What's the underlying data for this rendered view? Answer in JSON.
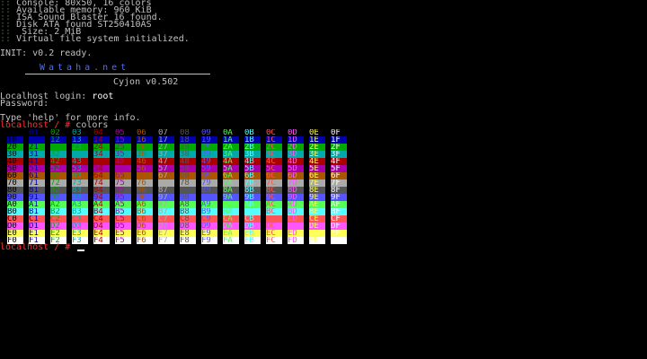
{
  "boot": {
    "lines": [
      "Console: 80x50, 16 colors",
      "Available memory: 960 KiB",
      "ISA Sound Blaster 16 found.",
      "Disk ATA found ST250410AS",
      " Size: 2 MiB",
      "Virtual file system initialized."
    ],
    "bullet": "::"
  },
  "init": {
    "label": "INIT:",
    "text": " v0.2 ready."
  },
  "banner": {
    "name": "Wataha.net",
    "version": "Cyjon v0.502"
  },
  "login": {
    "prompt": "Localhost login: ",
    "user": "root",
    "password_label": "Password:",
    "hint": "Type 'help' for more info."
  },
  "command": {
    "prompt": "localhost / # ",
    "text": "colors"
  },
  "final_prompt": "localhost / # ",
  "palette": {
    "rows": [
      [
        "00",
        "01",
        "02",
        "03",
        "04",
        "05",
        "06",
        "07",
        "08",
        "09",
        "0A",
        "0B",
        "0C",
        "0D",
        "0E",
        "0F"
      ],
      [
        "10",
        "11",
        "12",
        "13",
        "14",
        "15",
        "16",
        "17",
        "18",
        "19",
        "1A",
        "1B",
        "1C",
        "1D",
        "1E",
        "1F"
      ],
      [
        "20",
        "21",
        "22",
        "23",
        "24",
        "25",
        "26",
        "27",
        "28",
        "29",
        "2A",
        "2B",
        "2C",
        "2D",
        "2E",
        "2F"
      ],
      [
        "30",
        "31",
        "32",
        "33",
        "34",
        "35",
        "36",
        "37",
        "38",
        "39",
        "3A",
        "3B",
        "3C",
        "3D",
        "3E",
        "3F"
      ],
      [
        "40",
        "41",
        "42",
        "43",
        "44",
        "45",
        "46",
        "47",
        "48",
        "49",
        "4A",
        "4B",
        "4C",
        "4D",
        "4E",
        "4F"
      ],
      [
        "50",
        "51",
        "52",
        "53",
        "54",
        "55",
        "56",
        "57",
        "58",
        "59",
        "5A",
        "5B",
        "5C",
        "5D",
        "5E",
        "5F"
      ],
      [
        "60",
        "61",
        "62",
        "63",
        "64",
        "65",
        "66",
        "67",
        "68",
        "69",
        "6A",
        "6B",
        "6C",
        "6D",
        "6E",
        "6F"
      ],
      [
        "70",
        "71",
        "72",
        "73",
        "74",
        "75",
        "76",
        "77",
        "78",
        "79",
        "7A",
        "7B",
        "7C",
        "7D",
        "7E",
        "7F"
      ],
      [
        "80",
        "81",
        "82",
        "83",
        "84",
        "85",
        "86",
        "87",
        "88",
        "89",
        "8A",
        "8B",
        "8C",
        "8D",
        "8E",
        "8F"
      ],
      [
        "90",
        "91",
        "92",
        "93",
        "94",
        "95",
        "96",
        "97",
        "98",
        "99",
        "9A",
        "9B",
        "9C",
        "9D",
        "9E",
        "9F"
      ],
      [
        "A0",
        "A1",
        "A2",
        "A3",
        "A4",
        "A5",
        "A6",
        "A7",
        "A8",
        "A9",
        "AA",
        "AB",
        "AC",
        "AD",
        "AE",
        "AF"
      ],
      [
        "B0",
        "B1",
        "B2",
        "B3",
        "B4",
        "B5",
        "B6",
        "B7",
        "B8",
        "B9",
        "BA",
        "BB",
        "BC",
        "BD",
        "BE",
        "BF"
      ],
      [
        "C0",
        "C1",
        "C2",
        "C3",
        "C4",
        "C5",
        "C6",
        "C7",
        "C8",
        "C9",
        "CA",
        "CB",
        "CC",
        "CD",
        "CE",
        "CF"
      ],
      [
        "D0",
        "D1",
        "D2",
        "D3",
        "D4",
        "D5",
        "D6",
        "D7",
        "D8",
        "D9",
        "DA",
        "DB",
        "DC",
        "DD",
        "DE",
        "DF"
      ],
      [
        "E0",
        "E1",
        "E2",
        "E3",
        "E4",
        "E5",
        "E6",
        "E7",
        "E8",
        "E9",
        "EA",
        "EB",
        "EC",
        "ED",
        "EE",
        "EF"
      ],
      [
        "F0",
        "F1",
        "F2",
        "F3",
        "F4",
        "F5",
        "F6",
        "F7",
        "F8",
        "F9",
        "FA",
        "FB",
        "FC",
        "FD",
        "FE",
        "FF"
      ]
    ],
    "vga_colors": [
      "#000000",
      "#0000aa",
      "#00aa00",
      "#00aaaa",
      "#aa0000",
      "#aa00aa",
      "#aa5500",
      "#aaaaaa",
      "#555555",
      "#5555ff",
      "#55ff55",
      "#55ffff",
      "#ff5555",
      "#ff55ff",
      "#ffff55",
      "#ffffff"
    ]
  }
}
